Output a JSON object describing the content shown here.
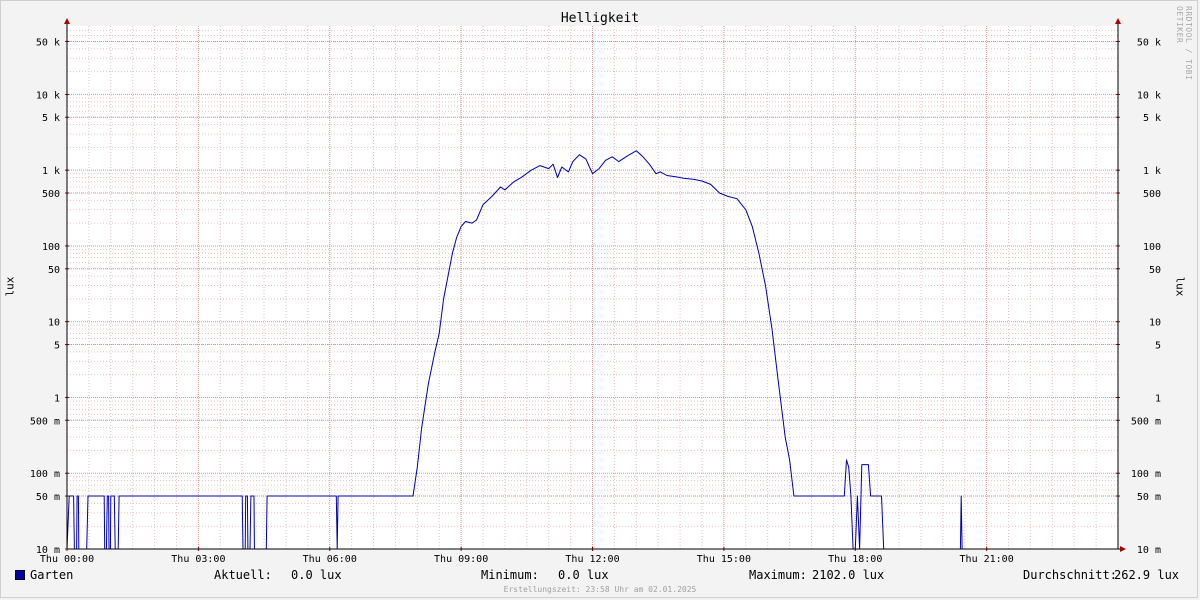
{
  "chart_data": {
    "type": "line",
    "title": "Helligkeit",
    "ylabel": "lux",
    "yscale": "log",
    "ylim": [
      0.01,
      80000
    ],
    "xlim": [
      0,
      24
    ],
    "grid": true,
    "y_ticks": [
      {
        "value": 50000,
        "label": "50 k"
      },
      {
        "value": 10000,
        "label": "10 k"
      },
      {
        "value": 5000,
        "label": "5 k"
      },
      {
        "value": 1000,
        "label": "1 k"
      },
      {
        "value": 500,
        "label": "500"
      },
      {
        "value": 100,
        "label": "100"
      },
      {
        "value": 50,
        "label": "50"
      },
      {
        "value": 10,
        "label": "10"
      },
      {
        "value": 5,
        "label": "5"
      },
      {
        "value": 1,
        "label": "1"
      },
      {
        "value": 0.5,
        "label": "500 m"
      },
      {
        "value": 0.1,
        "label": "100 m"
      },
      {
        "value": 0.05,
        "label": "50 m"
      },
      {
        "value": 0.01,
        "label": "10 m"
      }
    ],
    "x_ticks": [
      {
        "value": 0,
        "label": "Thu 00:00"
      },
      {
        "value": 3,
        "label": "Thu 03:00"
      },
      {
        "value": 6,
        "label": "Thu 06:00"
      },
      {
        "value": 9,
        "label": "Thu 09:00"
      },
      {
        "value": 12,
        "label": "Thu 12:00"
      },
      {
        "value": 15,
        "label": "Thu 15:00"
      },
      {
        "value": 18,
        "label": "Thu 18:00"
      },
      {
        "value": 21,
        "label": "Thu 21:00"
      }
    ],
    "series": [
      {
        "name": "Garten",
        "color": "#0000aa",
        "points": [
          [
            0.0,
            0.01
          ],
          [
            0.05,
            0.05
          ],
          [
            0.15,
            0.05
          ],
          [
            0.17,
            0.01
          ],
          [
            0.22,
            0.01
          ],
          [
            0.23,
            0.05
          ],
          [
            0.26,
            0.05
          ],
          [
            0.27,
            0.01
          ],
          [
            0.45,
            0.01
          ],
          [
            0.48,
            0.05
          ],
          [
            0.85,
            0.05
          ],
          [
            0.86,
            0.01
          ],
          [
            0.9,
            0.01
          ],
          [
            0.92,
            0.05
          ],
          [
            0.95,
            0.05
          ],
          [
            0.96,
            0.01
          ],
          [
            0.99,
            0.01
          ],
          [
            1.0,
            0.05
          ],
          [
            1.08,
            0.05
          ],
          [
            1.1,
            0.01
          ],
          [
            1.17,
            0.01
          ],
          [
            1.19,
            0.05
          ],
          [
            4.0,
            0.05
          ],
          [
            4.02,
            0.01
          ],
          [
            4.07,
            0.01
          ],
          [
            4.08,
            0.05
          ],
          [
            4.12,
            0.05
          ],
          [
            4.13,
            0.01
          ],
          [
            4.18,
            0.01
          ],
          [
            4.2,
            0.05
          ],
          [
            4.27,
            0.05
          ],
          [
            4.28,
            0.01
          ],
          [
            4.55,
            0.01
          ],
          [
            4.57,
            0.05
          ],
          [
            6.15,
            0.05
          ],
          [
            6.17,
            0.01
          ],
          [
            6.19,
            0.05
          ],
          [
            7.9,
            0.05
          ],
          [
            8.0,
            0.12
          ],
          [
            8.1,
            0.4
          ],
          [
            8.25,
            1.5
          ],
          [
            8.4,
            4
          ],
          [
            8.5,
            7
          ],
          [
            8.6,
            20
          ],
          [
            8.7,
            40
          ],
          [
            8.8,
            80
          ],
          [
            8.9,
            130
          ],
          [
            9.0,
            180
          ],
          [
            9.1,
            210
          ],
          [
            9.25,
            200
          ],
          [
            9.35,
            220
          ],
          [
            9.5,
            350
          ],
          [
            9.7,
            450
          ],
          [
            9.9,
            600
          ],
          [
            10.0,
            550
          ],
          [
            10.2,
            700
          ],
          [
            10.4,
            820
          ],
          [
            10.6,
            1000
          ],
          [
            10.8,
            1150
          ],
          [
            11.0,
            1050
          ],
          [
            11.1,
            1200
          ],
          [
            11.2,
            800
          ],
          [
            11.3,
            1100
          ],
          [
            11.45,
            950
          ],
          [
            11.55,
            1300
          ],
          [
            11.7,
            1600
          ],
          [
            11.85,
            1400
          ],
          [
            12.0,
            900
          ],
          [
            12.15,
            1050
          ],
          [
            12.3,
            1350
          ],
          [
            12.45,
            1500
          ],
          [
            12.6,
            1300
          ],
          [
            12.8,
            1550
          ],
          [
            13.0,
            1800
          ],
          [
            13.15,
            1500
          ],
          [
            13.3,
            1200
          ],
          [
            13.45,
            900
          ],
          [
            13.55,
            950
          ],
          [
            13.7,
            850
          ],
          [
            13.9,
            820
          ],
          [
            14.1,
            780
          ],
          [
            14.3,
            760
          ],
          [
            14.5,
            720
          ],
          [
            14.7,
            650
          ],
          [
            14.9,
            500
          ],
          [
            15.1,
            450
          ],
          [
            15.3,
            420
          ],
          [
            15.5,
            300
          ],
          [
            15.65,
            180
          ],
          [
            15.8,
            80
          ],
          [
            15.95,
            30
          ],
          [
            16.1,
            8
          ],
          [
            16.25,
            1.5
          ],
          [
            16.4,
            0.3
          ],
          [
            16.5,
            0.15
          ],
          [
            16.6,
            0.05
          ],
          [
            17.75,
            0.05
          ],
          [
            17.8,
            0.15
          ],
          [
            17.85,
            0.12
          ],
          [
            17.9,
            0.05
          ],
          [
            17.95,
            0.01
          ],
          [
            18.0,
            0.01
          ],
          [
            18.05,
            0.05
          ],
          [
            18.1,
            0.01
          ],
          [
            18.15,
            0.13
          ],
          [
            18.3,
            0.13
          ],
          [
            18.35,
            0.05
          ],
          [
            18.6,
            0.05
          ],
          [
            18.65,
            0.01
          ],
          [
            20.4,
            0.01
          ],
          [
            20.42,
            0.05
          ],
          [
            20.44,
            0.01
          ],
          [
            24.0,
            0.01
          ]
        ]
      }
    ]
  },
  "legend": {
    "series_name": "Garten",
    "current_label": "Aktuell:",
    "current_value": "0.0 lux",
    "min_label": "Minimum:",
    "min_value": "0.0 lux",
    "max_label": "Maximum:",
    "max_value": "2102.0 lux",
    "avg_label": "Durchschnitt:",
    "avg_value": "262.9 lux"
  },
  "footer": "Erstellungszeit: 23:58 Uhr am 02.01.2025",
  "watermark": "RRDTOOL / TOBI OETIKER",
  "colors": {
    "line": "#0000aa",
    "minor_grid": "#e4c4c4",
    "major_grid": "#e09090",
    "arrow": "#aa0000",
    "plot_bg": "#ffffff",
    "canvas_bg": "#f3f3f3"
  }
}
